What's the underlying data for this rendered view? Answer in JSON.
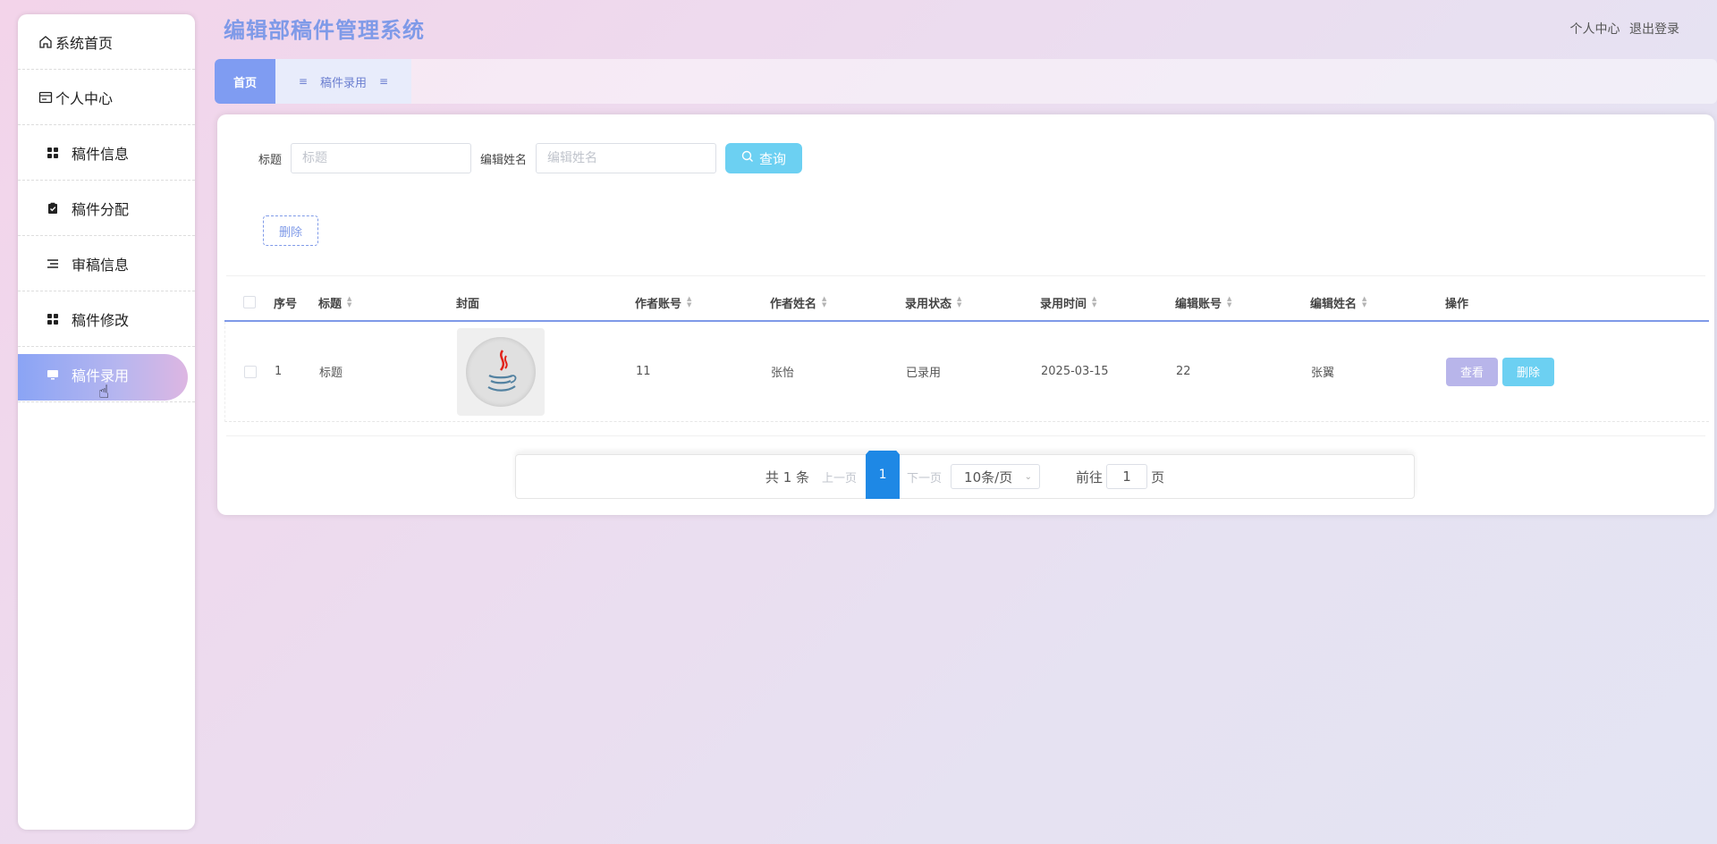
{
  "app": {
    "title": "编辑部稿件管理系统"
  },
  "header": {
    "profile_link": "个人中心",
    "logout_link": "退出登录"
  },
  "sidebar": {
    "items": [
      {
        "label": "系统首页",
        "icon": "home-icon"
      },
      {
        "label": "个人中心",
        "icon": "id-card-icon"
      },
      {
        "label": "稿件信息",
        "icon": "grid-icon"
      },
      {
        "label": "稿件分配",
        "icon": "clipboard-check-icon"
      },
      {
        "label": "审稿信息",
        "icon": "list-icon"
      },
      {
        "label": "稿件修改",
        "icon": "grid-icon"
      },
      {
        "label": "稿件录用",
        "icon": "monitor-icon",
        "active": true
      }
    ]
  },
  "tabs": {
    "home": "首页",
    "current": "稿件录用"
  },
  "search": {
    "title_label": "标题",
    "title_placeholder": "标题",
    "editor_label": "编辑姓名",
    "editor_placeholder": "编辑姓名",
    "query_button": "查询"
  },
  "actions": {
    "delete_button": "删除"
  },
  "table": {
    "headers": [
      "序号",
      "标题",
      "封面",
      "作者账号",
      "作者姓名",
      "录用状态",
      "录用时间",
      "编辑账号",
      "编辑姓名",
      "操作"
    ],
    "rows": [
      {
        "index": "1",
        "title": "标题",
        "cover": "java-logo-icon",
        "author_account": "11",
        "author_name": "张怡",
        "status": "已录用",
        "time": "2025-03-15",
        "editor_account": "22",
        "editor_name": "张翼",
        "view": "查看",
        "delete": "删除"
      }
    ]
  },
  "pagination": {
    "total": "共 1 条",
    "prev": "上一页",
    "current_page": "1",
    "next": "下一页",
    "page_size": "10条/页",
    "goto_label": "前往",
    "goto_value": "1",
    "goto_suffix": "页"
  },
  "colors": {
    "accent": "#7f9cf2",
    "cyan": "#6cd0f2",
    "lavender": "#b8b5ea"
  }
}
